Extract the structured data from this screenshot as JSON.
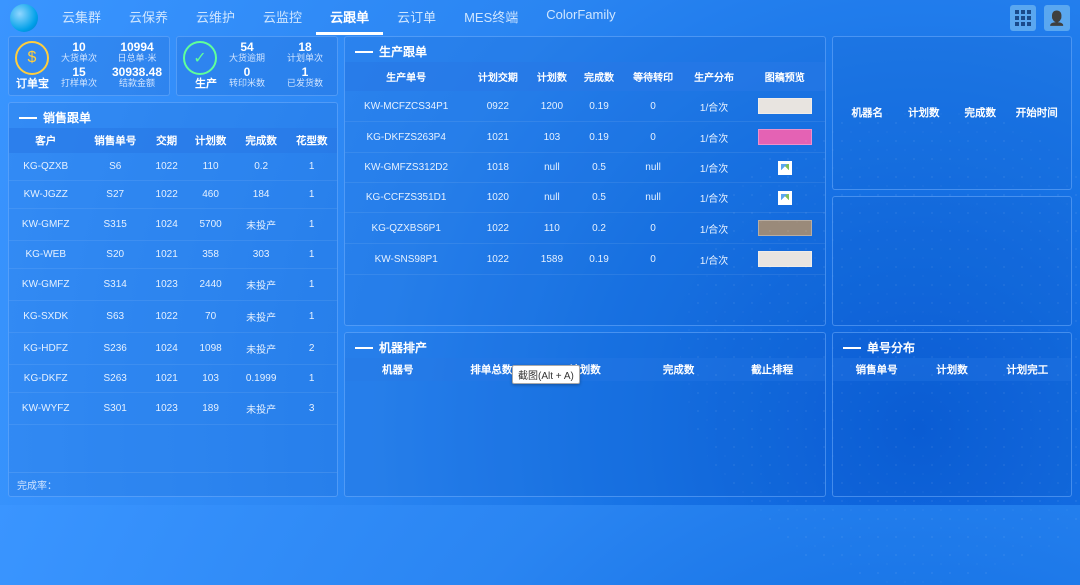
{
  "nav": {
    "items": [
      "云集群",
      "云保养",
      "云维护",
      "云监控",
      "云跟单",
      "云订单",
      "MES终端",
      "ColorFamily"
    ],
    "active_index": 4
  },
  "order_treasure_label": "订单宝",
  "production_label": "生产",
  "stats_left": [
    {
      "num": "10",
      "lbl": "大货单次"
    },
    {
      "num": "10994",
      "lbl": "日总单·米"
    },
    {
      "num": "15",
      "lbl": "打样单次"
    },
    {
      "num": "30938.48",
      "lbl": "结款金额"
    }
  ],
  "stats_right": [
    {
      "num": "54",
      "lbl": "大货逾期"
    },
    {
      "num": "18",
      "lbl": "计划单次"
    },
    {
      "num": "0",
      "lbl": "转印米数"
    },
    {
      "num": "1",
      "lbl": "已发货数"
    }
  ],
  "sales_panel": {
    "title": "销售跟单",
    "headers": [
      "客户",
      "销售单号",
      "交期",
      "计划数",
      "完成数",
      "花型数"
    ],
    "rows": [
      [
        "KG-QZXB",
        "S6",
        "1022",
        "110",
        "0.2",
        "1"
      ],
      [
        "KW-JGZZ",
        "S27",
        "1022",
        "460",
        "184",
        "1"
      ],
      [
        "KW-GMFZ",
        "S315",
        "1024",
        "5700",
        "未投产",
        "1"
      ],
      [
        "KG-WEB",
        "S20",
        "1021",
        "358",
        "303",
        "1"
      ],
      [
        "KW-GMFZ",
        "S314",
        "1023",
        "2440",
        "未投产",
        "1"
      ],
      [
        "KG-SXDK",
        "S63",
        "1022",
        "70",
        "未投产",
        "1"
      ],
      [
        "KG-HDFZ",
        "S236",
        "1024",
        "1098",
        "未投产",
        "2"
      ],
      [
        "KG-DKFZ",
        "S263",
        "1021",
        "103",
        "0.1999",
        "1"
      ],
      [
        "KW-WYFZ",
        "S301",
        "1023",
        "189",
        "未投产",
        "3"
      ]
    ],
    "footer": "完成率："
  },
  "prod_panel": {
    "title": "生产跟单",
    "headers": [
      "生产单号",
      "计划交期",
      "计划数",
      "完成数",
      "等待转印",
      "生产分布",
      "图稿预览"
    ],
    "rows": [
      {
        "cells": [
          "KW-MCFZCS34P1",
          "0922",
          "1200",
          "0.19",
          "0",
          "1/合次"
        ],
        "thumb": "plain"
      },
      {
        "cells": [
          "KG-DKFZS263P4",
          "1021",
          "103",
          "0.19",
          "0",
          "1/合次"
        ],
        "thumb": "pink"
      },
      {
        "cells": [
          "KW-GMFZS312D2",
          "1018",
          "null",
          "0.5",
          "null",
          "1/合次"
        ],
        "thumb": "missing"
      },
      {
        "cells": [
          "KG-CCFZS351D1",
          "1020",
          "null",
          "0.5",
          "null",
          "1/合次"
        ],
        "thumb": "missing"
      },
      {
        "cells": [
          "KG-QZXBS6P1",
          "1022",
          "110",
          "0.2",
          "0",
          "1/合次"
        ],
        "thumb": "gray"
      },
      {
        "cells": [
          "KW-SNS98P1",
          "1022",
          "1589",
          "0.19",
          "0",
          "1/合次"
        ],
        "thumb": "plain"
      }
    ]
  },
  "machine_info_headers": [
    "机器名",
    "计划数",
    "完成数",
    "开始时间"
  ],
  "machine_sched": {
    "title": "机器排产",
    "headers": [
      "机器号",
      "排单总数",
      "计划数",
      "完成数",
      "截止排程"
    ]
  },
  "order_dist": {
    "title": "单号分布",
    "headers": [
      "销售单号",
      "计划数",
      "计划完工"
    ]
  },
  "tooltip": "截图(Alt + A)"
}
